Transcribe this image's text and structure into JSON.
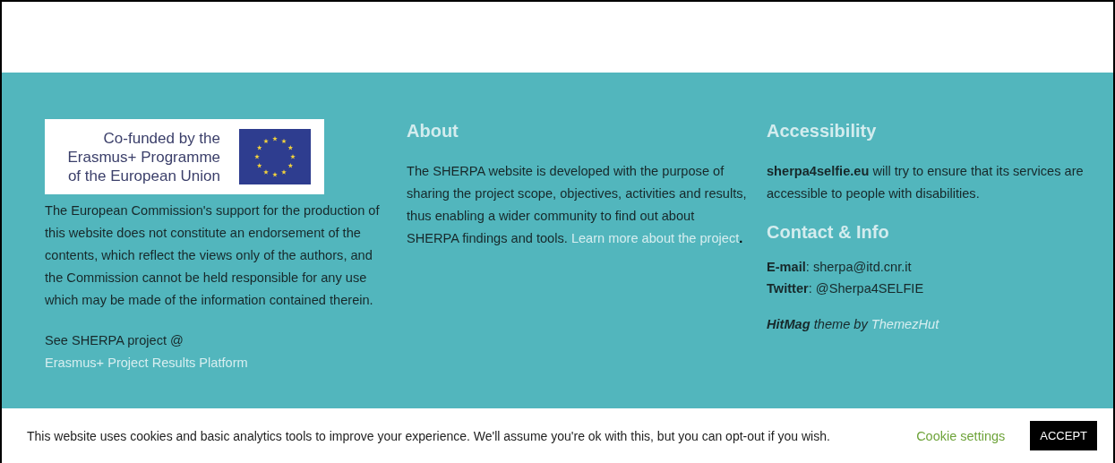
{
  "logo": {
    "lines": [
      "Co-funded by the",
      "Erasmus+ Programme",
      "of the European Union"
    ]
  },
  "disclaimer": "The European Commission's support for the production of this website does not constitute an endorsement of the contents, which reflect the views only of the authors, and the Commission cannot be held responsible for any use which may be made of the information contained therein.",
  "see_project": {
    "text": "See SHERPA project @",
    "link": "Erasmus+ Project Results Platform"
  },
  "about": {
    "heading": "About",
    "text": "The SHERPA website is developed with the purpose of sharing the project scope, objectives, activities and results, thus enabling a wider community to find out about SHERPA findings and tools.",
    "link": "Learn more about the project",
    "after": "."
  },
  "accessibility": {
    "heading": "Accessibility",
    "text": "**sherpa4selfie.eu** will try to ensure that its services are accessible to people with disabilities."
  },
  "contact": {
    "heading": "Contact & Info",
    "lines": [
      "**E-mail**: sherpa@itd.cnr.it",
      "**Twitter**: @Sherpa4SELFIE"
    ]
  },
  "credit": {
    "text": "**HitMag** theme by",
    "link": "ThemezHut"
  },
  "cookie_bar": {
    "text": "This website uses cookies and basic analytics tools to improve your experience. We'll assume you're ok with this, but you can opt-out if you wish.",
    "settings": "Cookie settings",
    "accept": "ACCEPT"
  }
}
